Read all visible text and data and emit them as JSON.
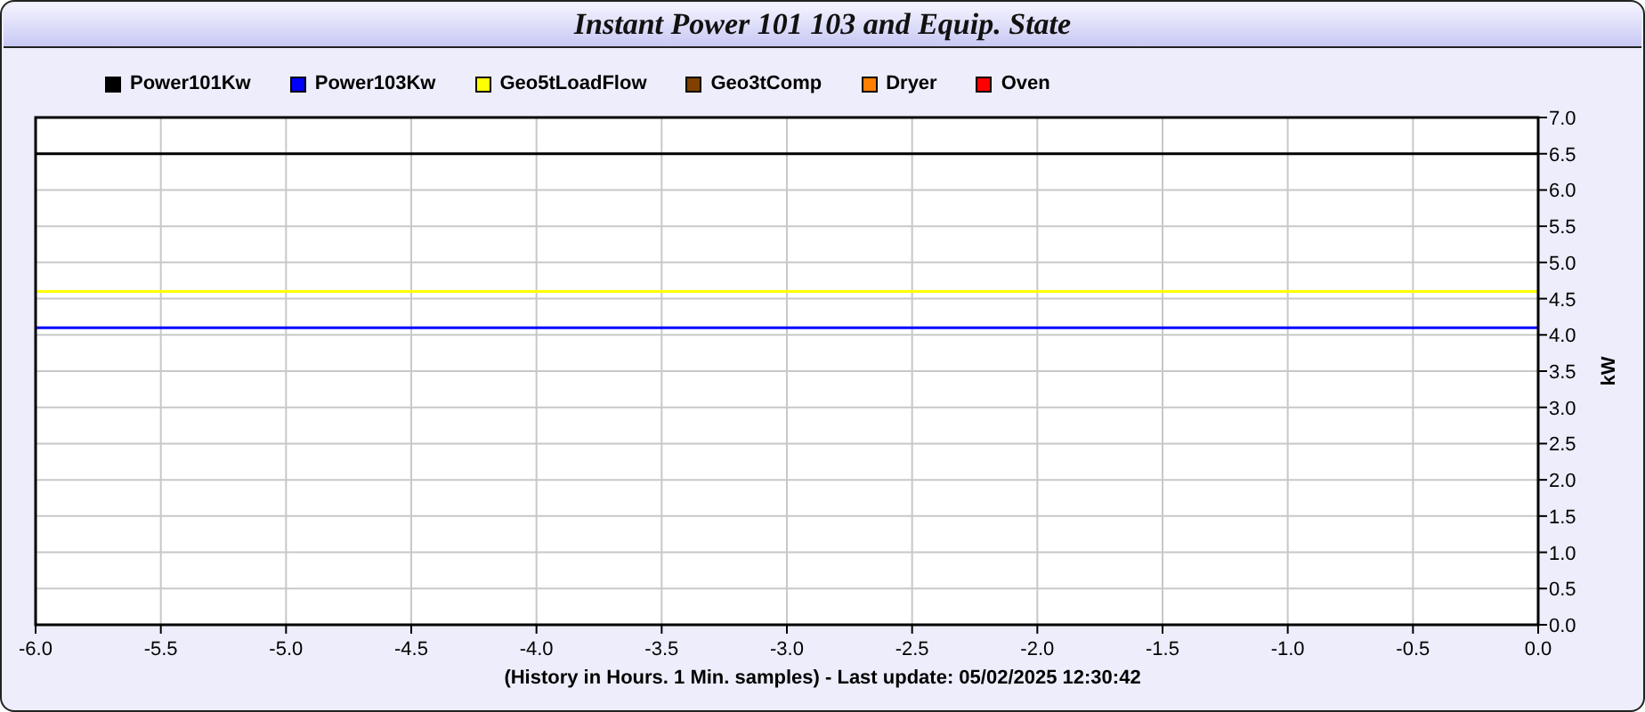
{
  "window": {
    "title": "Instant Power 101 103 and Equip. State"
  },
  "chart": {
    "chart_data": {
      "type": "line",
      "grid": true,
      "xlabel": "(History in Hours. 1 Min. samples) - Last update: 05/02/2025 12:30:42",
      "ylabel": "kW",
      "x": [
        -6.0,
        0.0
      ],
      "xlim": [
        -6,
        0
      ],
      "ylim": [
        0,
        7
      ],
      "xticks": [
        {
          "value": -6,
          "label": "-6.0"
        },
        {
          "value": -5.5,
          "label": "-5.5"
        },
        {
          "value": -5,
          "label": "-5.0"
        },
        {
          "value": -4.5,
          "label": "-4.5"
        },
        {
          "value": -4,
          "label": "-4.0"
        },
        {
          "value": -3.5,
          "label": "-3.5"
        },
        {
          "value": -3,
          "label": "-3.0"
        },
        {
          "value": -2.5,
          "label": "-2.5"
        },
        {
          "value": -2,
          "label": "-2.0"
        },
        {
          "value": -1.5,
          "label": "-1.5"
        },
        {
          "value": -1,
          "label": "-1.0"
        },
        {
          "value": -0.5,
          "label": "-0.5"
        },
        {
          "value": 0,
          "label": "0.0"
        }
      ],
      "yticks": [
        {
          "value": 0,
          "label": "0.0"
        },
        {
          "value": 0.5,
          "label": "0.5"
        },
        {
          "value": 1,
          "label": "1.0"
        },
        {
          "value": 1.5,
          "label": "1.5"
        },
        {
          "value": 2,
          "label": "2.0"
        },
        {
          "value": 2.5,
          "label": "2.5"
        },
        {
          "value": 3,
          "label": "3.0"
        },
        {
          "value": 3.5,
          "label": "3.5"
        },
        {
          "value": 4,
          "label": "4.0"
        },
        {
          "value": 4.5,
          "label": "4.5"
        },
        {
          "value": 5,
          "label": "5.0"
        },
        {
          "value": 5.5,
          "label": "5.5"
        },
        {
          "value": 6,
          "label": "6.0"
        },
        {
          "value": 6.5,
          "label": "6.5"
        },
        {
          "value": 7,
          "label": "7.0"
        }
      ],
      "series": [
        {
          "name": "Power101Kw",
          "color": "#000000",
          "values": [
            6.5,
            6.5
          ]
        },
        {
          "name": "Power103Kw",
          "color": "#0000ff",
          "values": [
            4.1,
            4.1
          ]
        },
        {
          "name": "Geo5tLoadFlow",
          "color": "#ffff00",
          "values": [
            4.6,
            4.6
          ]
        },
        {
          "name": "Geo3tComp",
          "color": "#804000",
          "values": [
            null,
            null
          ]
        },
        {
          "name": "Dryer",
          "color": "#ff8000",
          "values": [
            null,
            null
          ]
        },
        {
          "name": "Oven",
          "color": "#ff0000",
          "values": [
            null,
            null
          ]
        }
      ]
    }
  }
}
